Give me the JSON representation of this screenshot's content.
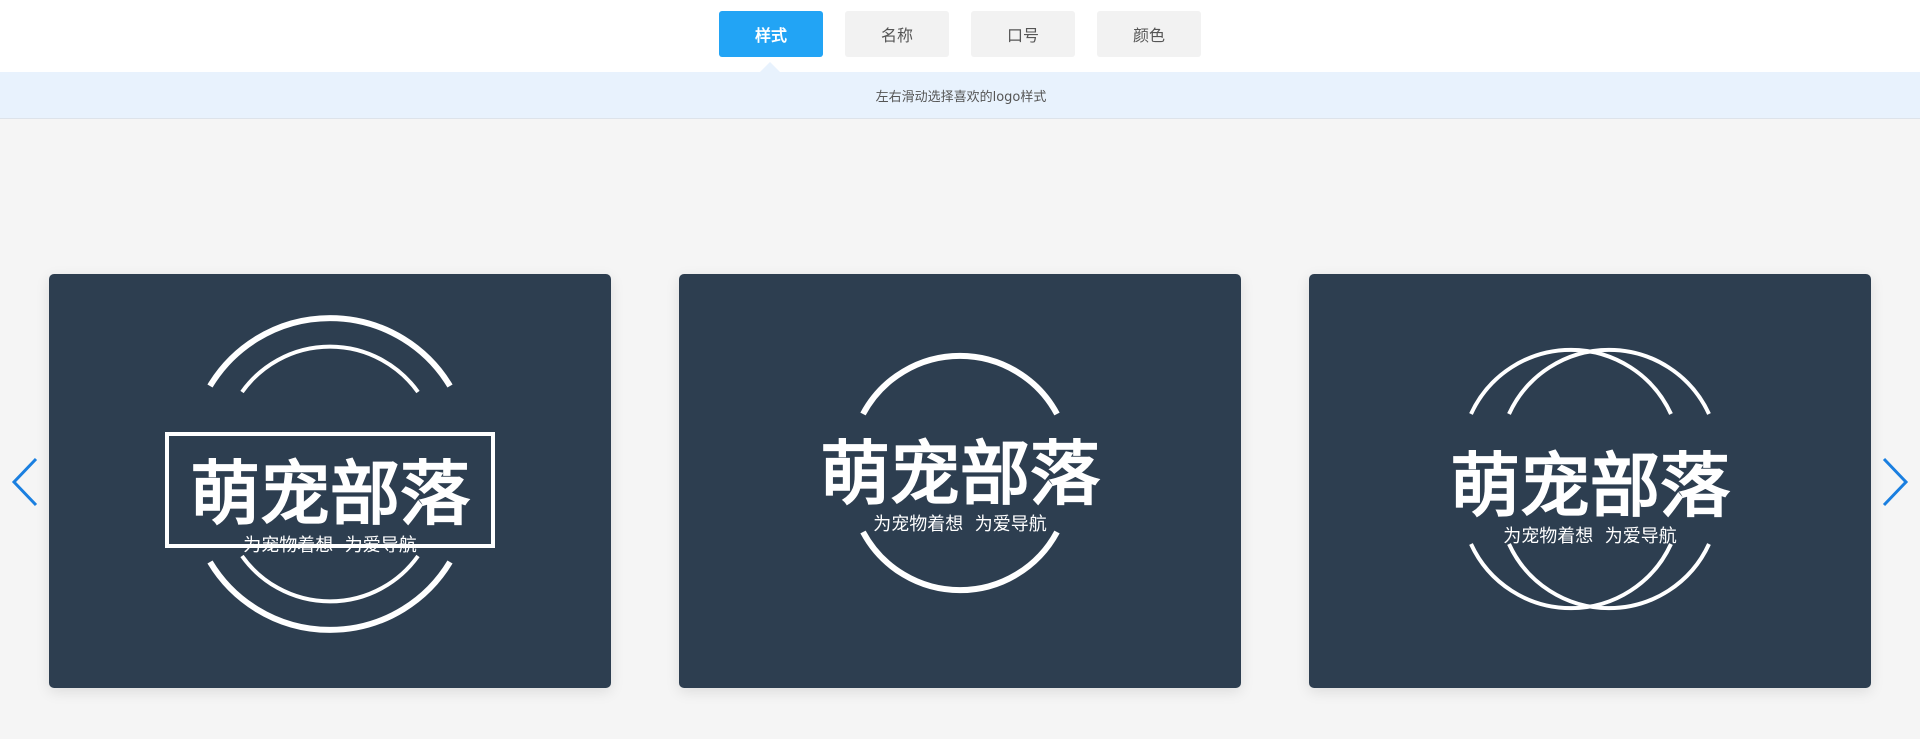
{
  "tabs": [
    {
      "label": "样式",
      "active": true
    },
    {
      "label": "名称",
      "active": false
    },
    {
      "label": "口号",
      "active": false
    },
    {
      "label": "颜色",
      "active": false
    }
  ],
  "hint": "左右滑动选择喜欢的logo样式",
  "logos": [
    {
      "title": "萌宠部落",
      "slogan": "为宠物着想  为爱导航",
      "style": "circle-rectangle"
    },
    {
      "title": "萌宠部落",
      "slogan": "为宠物着想  为爱导航",
      "style": "single-circle"
    },
    {
      "title": "萌宠部落",
      "slogan": "为宠物着想  为爱导航",
      "style": "double-circle"
    }
  ],
  "icons": {
    "prev": "chevron-left-icon",
    "next": "chevron-right-icon"
  },
  "colors": {
    "accent": "#22a4f5",
    "card_background": "#2d3e50",
    "hint_background": "#e8f2fd",
    "page_background": "#f5f5f5",
    "arrow": "#1a7fe0"
  }
}
